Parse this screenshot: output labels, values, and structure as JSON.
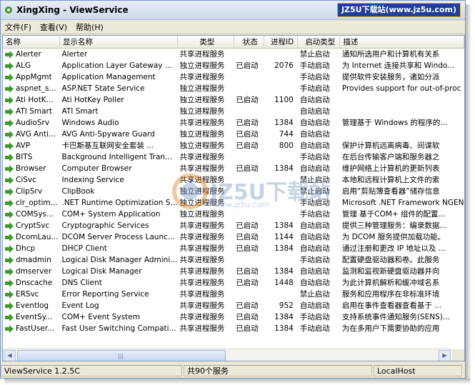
{
  "window": {
    "title": "XingXing - ViewService",
    "brand_badge": "JZ5U下载站(www.jz5u.com)"
  },
  "menu": [
    {
      "label": "文件(F)"
    },
    {
      "label": "查看(V)"
    },
    {
      "label": "帮助(H)"
    }
  ],
  "columns": [
    "名称",
    "显示名称",
    "类型",
    "状态",
    "进程ID",
    "启动类型",
    "描述"
  ],
  "rows": [
    {
      "name": "Alerter",
      "display": "Alerter",
      "type": "共享进程服务",
      "status": "",
      "pid": "",
      "startup": "禁止启动",
      "desc": "通知所选用户和计算机有关系"
    },
    {
      "name": "ALG",
      "display": "Application Layer Gateway ...",
      "type": "独立进程服务",
      "status": "已启动",
      "pid": "2076",
      "startup": "手动启动",
      "desc": "为 Internet 连接共享和 Windo..."
    },
    {
      "name": "AppMgmt",
      "display": "Application Management",
      "type": "共享进程服务",
      "status": "",
      "pid": "",
      "startup": "手动启动",
      "desc": "提供软件安装服务，诸如分派"
    },
    {
      "name": "aspnet_s...",
      "display": "ASP.NET State Service",
      "type": "独立进程服务",
      "status": "",
      "pid": "",
      "startup": "手动启动",
      "desc": "Provides support for out-of-proc"
    },
    {
      "name": "Ati HotK...",
      "display": "Ati HotKey Poller",
      "type": "独立进程服务",
      "status": "已启动",
      "pid": "1100",
      "startup": "自动启动",
      "desc": ""
    },
    {
      "name": "ATI Smart",
      "display": "ATI Smart",
      "type": "独立进程服务",
      "status": "",
      "pid": "",
      "startup": "自动启动",
      "desc": ""
    },
    {
      "name": "AudioSrv",
      "display": "Windows Audio",
      "type": "共享进程服务",
      "status": "已启动",
      "pid": "1384",
      "startup": "自动启动",
      "desc": "管理基于 Windows 的程序的..."
    },
    {
      "name": "AVG Anti...",
      "display": "AVG Anti-Spyware Guard",
      "type": "独立进程服务",
      "status": "已启动",
      "pid": "744",
      "startup": "自动启动",
      "desc": ""
    },
    {
      "name": "AVP",
      "display": "卡巴斯基互联网安全套装 ...",
      "type": "独立进程服务",
      "status": "已启动",
      "pid": "800",
      "startup": "自动启动",
      "desc": "保护计算机远离病毒、间谍软"
    },
    {
      "name": "BITS",
      "display": "Background Intelligent Tran...",
      "type": "共享进程服务",
      "status": "",
      "pid": "",
      "startup": "手动启动",
      "desc": "在后台传输客户端和服务器之"
    },
    {
      "name": "Browser",
      "display": "Computer Browser",
      "type": "共享进程服务",
      "status": "已启动",
      "pid": "1384",
      "startup": "自动启动",
      "desc": "维护网络上计算机的更新列表"
    },
    {
      "name": "CiSvc",
      "display": "Indexing Service",
      "type": "共享进程服务",
      "status": "",
      "pid": "",
      "startup": "禁止启动",
      "desc": "本地和远程计算机上文件的索"
    },
    {
      "name": "ClipSrv",
      "display": "ClipBook",
      "type": "独立进程服务",
      "status": "",
      "pid": "",
      "startup": "禁止启动",
      "desc": "启用“剪贴簿查看器”储存信息"
    },
    {
      "name": "clr_optim...",
      "display": ".NET Runtime Optimization S...",
      "type": "独立进程服务",
      "status": "",
      "pid": "",
      "startup": "手动启动",
      "desc": "Microsoft .NET Framework NGEN"
    },
    {
      "name": "COMSys...",
      "display": "COM+ System Application",
      "type": "独立进程服务",
      "status": "",
      "pid": "",
      "startup": "手动启动",
      "desc": "管理 基于COM+ 组件的配置..."
    },
    {
      "name": "CryptSvc",
      "display": "Cryptographic Services",
      "type": "共享进程服务",
      "status": "已启动",
      "pid": "1384",
      "startup": "自动启动",
      "desc": "提供三种管理服务：编录数据..."
    },
    {
      "name": "DcomLau...",
      "display": "DCOM Server Process Launc...",
      "type": "共享进程服务",
      "status": "已启动",
      "pid": "1144",
      "startup": "自动启动",
      "desc": "为 DCOM 服务提供加载功能。"
    },
    {
      "name": "Dhcp",
      "display": "DHCP Client",
      "type": "共享进程服务",
      "status": "已启动",
      "pid": "1384",
      "startup": "自动启动",
      "desc": "通过注册和更改 IP 地址以及 ..."
    },
    {
      "name": "dmadmin",
      "display": "Logical Disk Manager Admini...",
      "type": "共享进程服务",
      "status": "",
      "pid": "",
      "startup": "手动启动",
      "desc": "配置硬盘驱动器和卷。此服务"
    },
    {
      "name": "dmserver",
      "display": "Logical Disk Manager",
      "type": "共享进程服务",
      "status": "已启动",
      "pid": "1384",
      "startup": "自动启动",
      "desc": "监测和监视新硬盘驱动器并向"
    },
    {
      "name": "Dnscache",
      "display": "DNS Client",
      "type": "共享进程服务",
      "status": "已启动",
      "pid": "1448",
      "startup": "自动启动",
      "desc": "为此计算机解析和缓冲域名系"
    },
    {
      "name": "ERSvc",
      "display": "Error Reporting Service",
      "type": "共享进程服务",
      "status": "",
      "pid": "",
      "startup": "禁止启动",
      "desc": "服务和应用程序在非标准环境"
    },
    {
      "name": "Eventlog",
      "display": "Event Log",
      "type": "共享进程服务",
      "status": "已启动",
      "pid": "952",
      "startup": "自动启动",
      "desc": "启用在事件查看器查看基于 ..."
    },
    {
      "name": "EventSy...",
      "display": "COM+ Event System",
      "type": "共享进程服务",
      "status": "已启动",
      "pid": "1384",
      "startup": "手动启动",
      "desc": "支持系统事件通知服务(SENS)..."
    },
    {
      "name": "FastUser...",
      "display": "Fast User Switching Compati...",
      "type": "共享进程服务",
      "status": "已启动",
      "pid": "1384",
      "startup": "手动启动",
      "desc": "为在多用户下需要协助的应用"
    }
  ],
  "statusbar": {
    "app": "ViewService 1.2.5C",
    "count": "共90个服务",
    "machine": "LocalHost"
  },
  "watermark": {
    "text": "JZ5U下载站",
    "url": "www.jz5u.com"
  },
  "colors": {
    "accent": "#7a96c4",
    "gear_green": "#3f9a2d"
  },
  "icons": {
    "row": "green-arrow-gear-icon",
    "title": "gear-app-icon"
  }
}
